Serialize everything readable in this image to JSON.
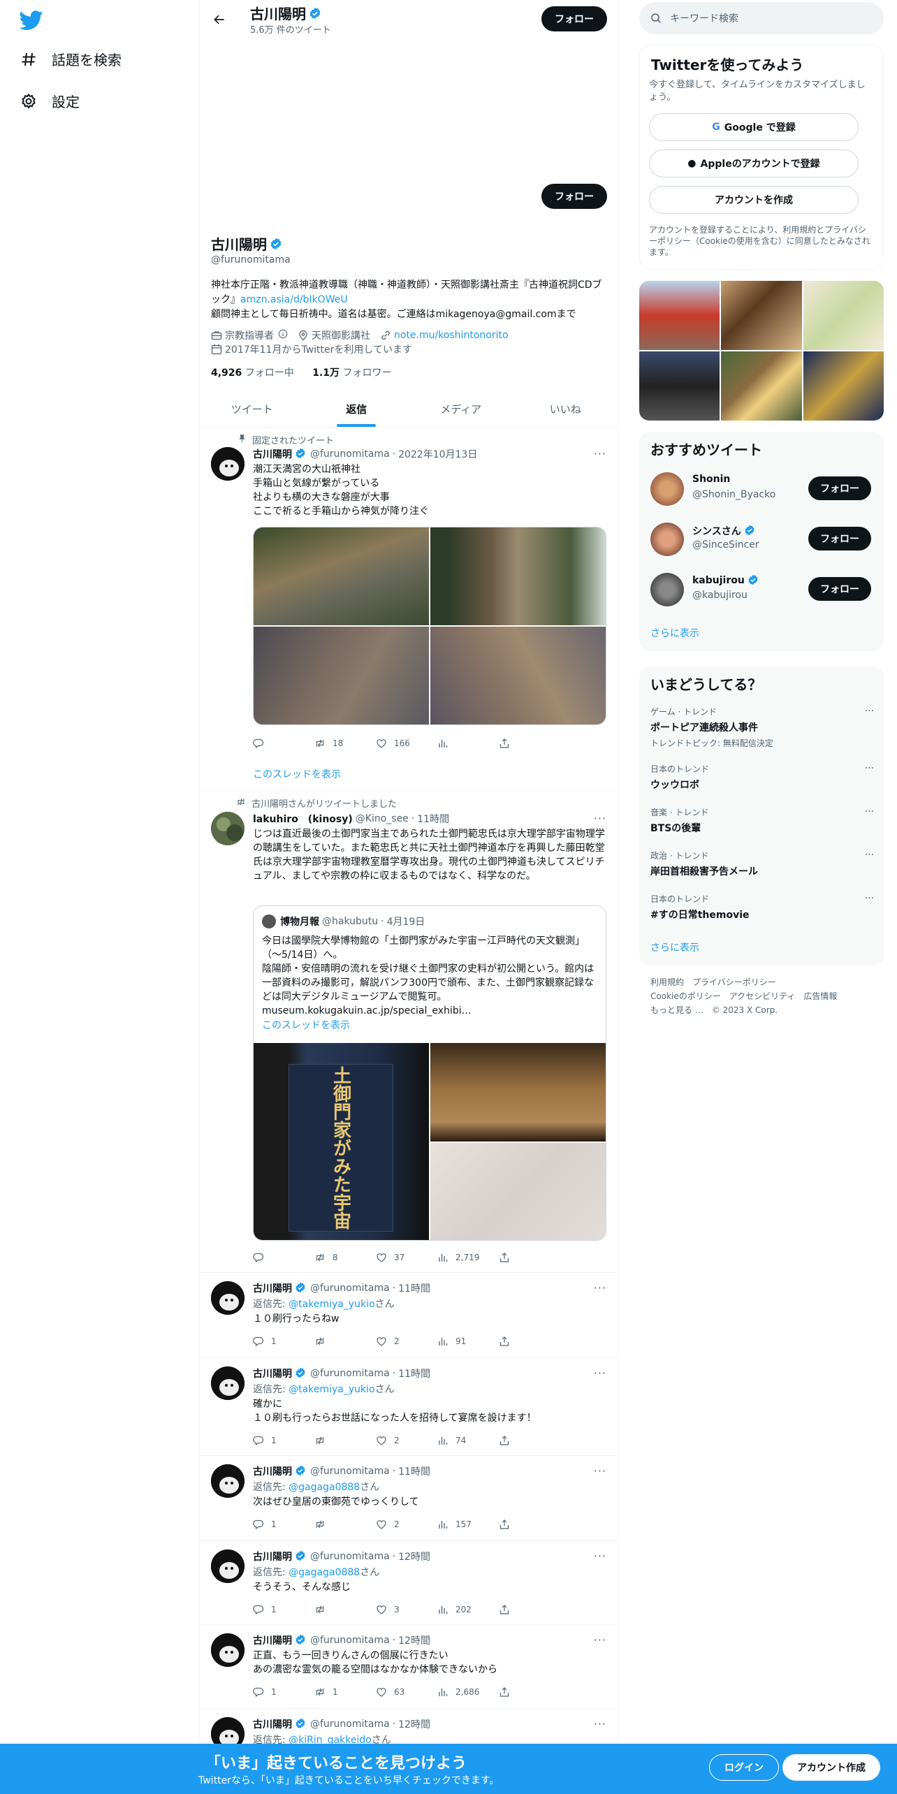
{
  "nav": {
    "explore": "話題を検索",
    "settings": "設定"
  },
  "header": {
    "name": "古川陽明",
    "tweet_count": "5.6万 件のツイート",
    "follow": "フォロー"
  },
  "profile": {
    "name": "古川陽明",
    "handle": "@furunomitama",
    "follow": "フォロー",
    "bio1": "神社本庁正階・教派神道教導職（神職・神道教師）・天照御影講社斎主『古神道祝詞CDブック』",
    "bio_link": "amzn.asia/d/bIkOWeU",
    "bio2": "顧問神主として毎日祈祷中。道名は基密。ご連絡はmikagenoya@gmail.comまで",
    "category": "宗教指導者",
    "location": "天照御影講社",
    "website": "note.mu/koshintonorito",
    "joined": "2017年11月からTwitterを利用しています",
    "following_num": "4,926",
    "following_label": " フォロー中",
    "followers_num": "1.1万",
    "followers_label": " フォロワー"
  },
  "tabs": [
    "ツイート",
    "返信",
    "メディア",
    "いいね"
  ],
  "pinned": {
    "label": "固定されたツイート",
    "name": "古川陽明",
    "handle": "@furunomitama",
    "date": "2022年10月13日",
    "text": "潮江天満宮の大山祇神社\n手箱山と気線が繋がっている\n社よりも横の大きな磐座が大事\nここで祈ると手箱山から神気が降り注ぐ",
    "retweets": "18",
    "likes": "166",
    "show_thread": "このスレッドを表示"
  },
  "retweet": {
    "context": "古川陽明さんがリツイートしました",
    "name": "lakuhiro　(kinosy)",
    "handle": "@Kino_see",
    "time": "11時間",
    "text": "じつは直近最後の土御門家当主であられた土御門範忠氏は京大理学部宇宙物理学の聴講生をしていた。また範忠氏と共に天社土御門神道本庁を再興した藤田乾堂氏は京大理学部宇宙物理教室暦学専攻出身。現代の土御門神道も決してスピリチュアル、ましてや宗教の枠に収まるものではなく、科学なのだ。",
    "quote_name": "博物月報",
    "quote_handle": "@hakubutu",
    "quote_date": "4月19日",
    "quote_text": "今日は國學院大學博物館の「土御門家がみた宇宙ー江戸時代の天文観測」（〜5/14日）へ。\n陰陽師・安倍晴明の流れを受け継ぐ土御門家の史料が初公開という。館内は一部資料のみ撮影可，解説パンフ300円で頒布、また、土御門家観察記録などは同大デジタルミュージアムで閲覧可。\nmuseum.kokugakuin.ac.jp/special_exhibi…",
    "quote_show_thread": "このスレッドを表示",
    "poster_text": "土御門家がみた宇宙",
    "retweets": "8",
    "likes": "37",
    "views": "2,719"
  },
  "replies": [
    {
      "name": "古川陽明",
      "handle": "@furunomitama",
      "time": "11時間",
      "reply_label": "返信先: ",
      "reply_to": "@takemiya_yukio",
      "reply_suffix": "さん",
      "text": "１０刷行ったらねw",
      "replies": "1",
      "retweets": "",
      "likes": "2",
      "views": "91"
    },
    {
      "name": "古川陽明",
      "handle": "@furunomitama",
      "time": "11時間",
      "reply_label": "返信先: ",
      "reply_to": "@takemiya_yukio",
      "reply_suffix": "さん",
      "text": "確かに\n１０刷も行ったらお世話になった人を招待して宴席を設けます！",
      "replies": "1",
      "retweets": "",
      "likes": "2",
      "views": "74"
    },
    {
      "name": "古川陽明",
      "handle": "@furunomitama",
      "time": "11時間",
      "reply_label": "返信先: ",
      "reply_to": "@gagaga0888",
      "reply_suffix": "さん",
      "text": "次はぜひ皇居の東御苑でゆっくりして",
      "replies": "1",
      "retweets": "",
      "likes": "2",
      "views": "157"
    },
    {
      "name": "古川陽明",
      "handle": "@furunomitama",
      "time": "12時間",
      "reply_label": "返信先: ",
      "reply_to": "@gagaga0888",
      "reply_suffix": "さん",
      "text": "そうそう、そんな感じ",
      "replies": "1",
      "retweets": "",
      "likes": "3",
      "views": "202"
    },
    {
      "name": "古川陽明",
      "handle": "@furunomitama",
      "time": "12時間",
      "reply_label": "",
      "reply_to": "",
      "reply_suffix": "",
      "text": "正直、もう一回きりんさんの個展に行きたい\nあの濃密な霊気の籠る空間はなかなか体験できないから",
      "replies": "1",
      "retweets": "1",
      "likes": "63",
      "views": "2,686"
    },
    {
      "name": "古川陽明",
      "handle": "@furunomitama",
      "time": "12時間",
      "reply_label": "返信先: ",
      "reply_to": "@kiRin_gakkeido",
      "reply_suffix": "さん",
      "text": "",
      "replies": "",
      "retweets": "",
      "likes": "",
      "views": ""
    }
  ],
  "sidebar": {
    "search_placeholder": "キーワード検索",
    "signup_title": "Twitterを使ってみよう",
    "signup_sub": "今すぐ登録して、タイムラインをカスタマイズしましょう。",
    "google": "Google で登録",
    "apple": "Appleのアカウントで登録",
    "create": "アカウントを作成",
    "terms": "アカウントを登録することにより、利用規約とプライバシーポリシー（Cookieの使用を含む）に同意したとみなされます。",
    "rec_title": "おすすめツイート",
    "recs": [
      {
        "name": "Shonin",
        "handle": "@Shonin_Byacko",
        "follow": "フォロー"
      },
      {
        "name": "シンスさん",
        "handle": "@SinceSincer",
        "follow": "フォロー"
      },
      {
        "name": "kabujirou",
        "handle": "@kabujirou",
        "follow": "フォロー"
      }
    ],
    "show_more": "さらに表示",
    "trends_title": "いまどうしてる？",
    "trends": [
      {
        "cat": "ゲーム · トレンド",
        "name": "ポートピア連続殺人事件",
        "extra": "トレンドトピック: 無料配信決定"
      },
      {
        "cat": "日本のトレンド",
        "name": "ウッウロボ",
        "extra": ""
      },
      {
        "cat": "音楽 · トレンド",
        "name": "BTSの後輩",
        "extra": ""
      },
      {
        "cat": "政治 · トレンド",
        "name": "岸田首相殺害予告メール",
        "extra": ""
      },
      {
        "cat": "日本のトレンド",
        "name": "#すの日常themovie",
        "extra": ""
      }
    ],
    "trends_more": "さらに表示",
    "footer1": "利用規約　プライバシーポリシー",
    "footer2": "Cookieのポリシー　アクセシビリティ　広告情報",
    "footer3": "もっと見る …　© 2023 X Corp."
  },
  "bottom": {
    "title": "「いま」起きていることを見つけよう",
    "sub": "Twitterなら、「いま」起きていることをいち早くチェックできます。",
    "login": "ログイン",
    "signup": "アカウント作成"
  }
}
